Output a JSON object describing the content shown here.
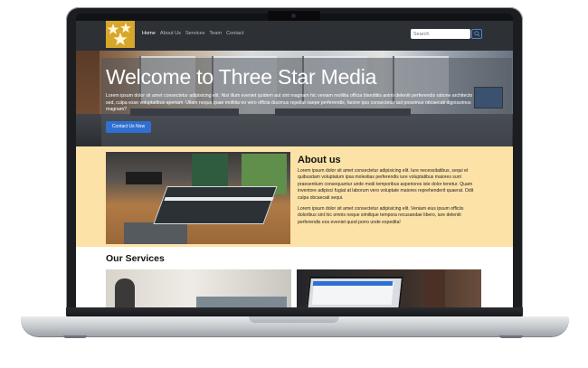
{
  "nav": {
    "links": [
      "Home",
      "About Us",
      "Services",
      "Team",
      "Contact"
    ],
    "search_placeholder": "Search"
  },
  "hero": {
    "title": "Welcome to Three Star Media",
    "text": "Lorem ipsum dolor sit amet consectetur adipisicing elit. Nisi illum eveniet quidem aut sint magnam hic veniam mollitia officia blanditiis animi deleniti perferendis ratione architecto sed, culpa esse voluptatibus aperiam. Ullam neque quae mollitia eo vero officia ducimus repellat saepe perferendis, facere quo consectetur aut possimus obcaecati dignissimos magnam?",
    "button_label": "Contact Us Now"
  },
  "about": {
    "title": "About us",
    "p1": "Lorem ipsum dolor sit amet consectetur adipisicing elit. Iure necessitatibus, sequi et quibusdam voluptatum ipsa molestias perferendis iure voluptatibus maiores sunt praesentium consequuntur unde modi temporibus asperiores iste dolor tenetur. Quam inventore adipisci fugiat at laborum vero voluptate maiores reprehenderit quaerat. Odit culpa obcaecati sequi.",
    "p2": "Lorem ipsum dolor sit amet consectetur adipisicing elit. Veniam eius ipsum officiis doloribus sint hic omnis neque similique tempora recusandae libero, iure deleniti perferendis eos eveniet quod porro unde expedita!"
  },
  "services": {
    "title": "Our Services"
  },
  "colors": {
    "navbar": "#2d3035",
    "logo": "#d6a72b",
    "about_bg": "#fde2a7",
    "button": "#2f6fd2"
  }
}
